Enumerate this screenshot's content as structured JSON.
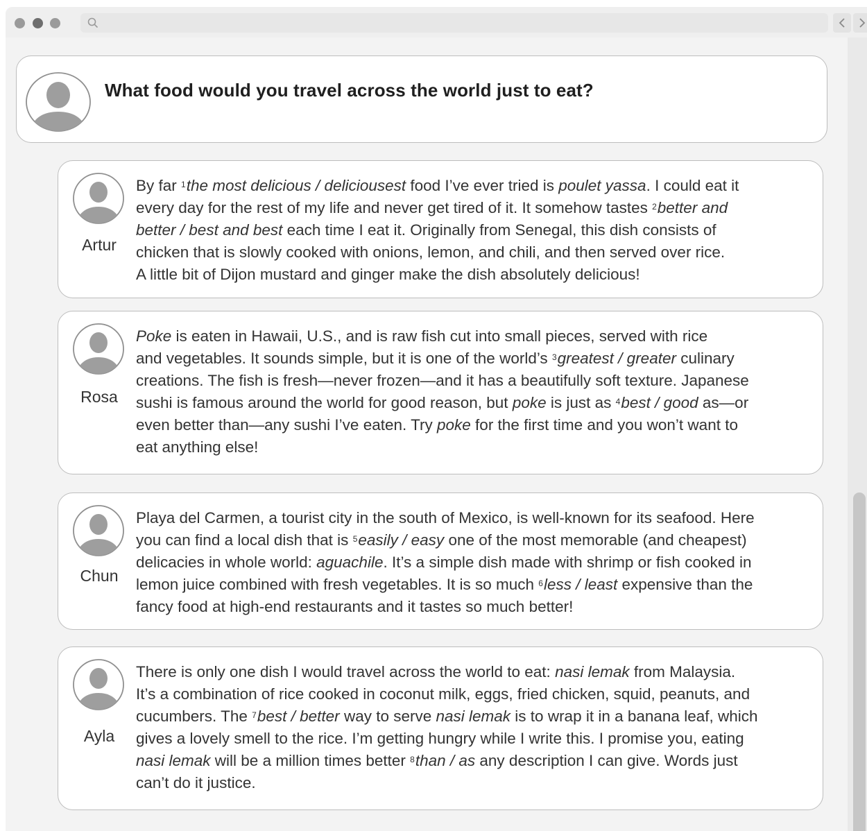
{
  "window": {
    "buttons": [
      "window-control-1",
      "window-control-2",
      "window-control-3"
    ],
    "icons": {
      "search": "search-icon",
      "back": "chevron-left-icon",
      "forward": "chevron-right-icon"
    }
  },
  "question": {
    "text": "What food would you travel across the world just to eat?",
    "avatar_icon": "user-avatar-icon"
  },
  "answers": [
    {
      "name": "Artur",
      "lines": [
        [
          {
            "t": "By far "
          },
          {
            "sup": "1"
          },
          {
            "i": "the most delicious / deliciousest"
          },
          {
            "t": " food I’ve ever tried is "
          },
          {
            "i": "poulet yassa"
          },
          {
            "t": ". I could eat it"
          }
        ],
        [
          {
            "t": "every day for the rest of my life and never get tired of it. It somehow tastes "
          },
          {
            "sup": "2"
          },
          {
            "i": "better and"
          }
        ],
        [
          {
            "i": "better / best and best"
          },
          {
            "t": " each time I eat it. Originally from Senegal, this dish consists of"
          }
        ],
        [
          {
            "t": "chicken that is slowly cooked with onions, lemon, and chili, and then served over rice."
          }
        ],
        [
          {
            "t": "A little bit of Dijon mustard and ginger make the dish absolutely delicious!"
          }
        ]
      ]
    },
    {
      "name": "Rosa",
      "lines": [
        [
          {
            "i": "Poke"
          },
          {
            "t": " is eaten in Hawaii, U.S., and is raw fish cut into small pieces, served with rice"
          }
        ],
        [
          {
            "t": "and vegetables. It sounds simple, but it is one of the world’s "
          },
          {
            "sup": "3"
          },
          {
            "i": "greatest / greater"
          },
          {
            "t": " culinary"
          }
        ],
        [
          {
            "t": "creations. The fish is fresh—never frozen—and it has a beautifully soft texture. Japanese"
          }
        ],
        [
          {
            "t": "sushi is famous around the world for good reason, but "
          },
          {
            "i": "poke"
          },
          {
            "t": " is just as "
          },
          {
            "sup": "4"
          },
          {
            "i": "best / good"
          },
          {
            "t": " as—or"
          }
        ],
        [
          {
            "t": "even better than—any sushi I’ve eaten. Try "
          },
          {
            "i": "poke"
          },
          {
            "t": " for the first time and you won’t want to"
          }
        ],
        [
          {
            "t": "eat anything else!"
          }
        ]
      ]
    },
    {
      "name": "Chun",
      "lines": [
        [
          {
            "t": "Playa del Carmen, a tourist city in the south of Mexico, is well-known for its seafood. Here"
          }
        ],
        [
          {
            "t": "you can find a local dish that is "
          },
          {
            "sup": "5"
          },
          {
            "i": "easily / easy"
          },
          {
            "t": " one of the most memorable (and cheapest)"
          }
        ],
        [
          {
            "t": "delicacies in whole world: "
          },
          {
            "i": "aguachile"
          },
          {
            "t": ". It’s a simple dish made with shrimp or fish cooked in"
          }
        ],
        [
          {
            "t": "lemon juice combined with fresh vegetables. It is so much "
          },
          {
            "sup": "6"
          },
          {
            "i": "less / least"
          },
          {
            "t": " expensive than the"
          }
        ],
        [
          {
            "t": "fancy food at high-end restaurants and it tastes so much better!"
          }
        ]
      ]
    },
    {
      "name": "Ayla",
      "lines": [
        [
          {
            "t": "There is only one dish I would travel across the world to eat: "
          },
          {
            "i": "nasi lemak"
          },
          {
            "t": " from Malaysia."
          }
        ],
        [
          {
            "t": "It’s a combination of rice cooked in coconut milk, eggs, fried chicken, squid, peanuts, and"
          }
        ],
        [
          {
            "t": "cucumbers. The "
          },
          {
            "sup": "7"
          },
          {
            "i": "best / better"
          },
          {
            "t": " way to serve "
          },
          {
            "i": "nasi lemak"
          },
          {
            "t": " is to wrap it in a banana leaf, which"
          }
        ],
        [
          {
            "t": "gives a lovely smell to the rice. I’m getting hungry while I write this. I promise you, eating"
          }
        ],
        [
          {
            "i": "nasi lemak"
          },
          {
            "t": " will be a million times better "
          },
          {
            "sup": "8"
          },
          {
            "i": "than / as"
          },
          {
            "t": " any description I can give. Words just"
          }
        ],
        [
          {
            "t": "can’t do it justice."
          }
        ]
      ]
    }
  ],
  "colors": {
    "avatar": "#9e9e9e",
    "card_border": "#bdbdbd",
    "background": "#f3f3f3"
  }
}
